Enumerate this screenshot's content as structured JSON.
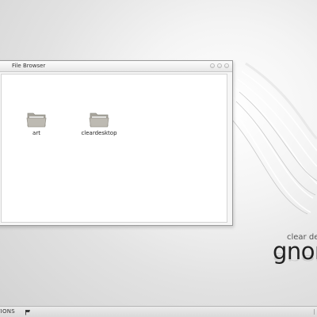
{
  "window": {
    "title": "File Browser",
    "items": [
      {
        "name": "art",
        "icon": "folder-icon"
      },
      {
        "name": "cleardesktop",
        "icon": "folder-icon"
      }
    ]
  },
  "branding": {
    "small": "clear de",
    "big": "gnor"
  },
  "panel": {
    "apps_label": "TIONS",
    "flag_icon": "flag-icon"
  },
  "colors": {
    "folder": "#b9b6ae",
    "folder_dark": "#9e9b93"
  }
}
